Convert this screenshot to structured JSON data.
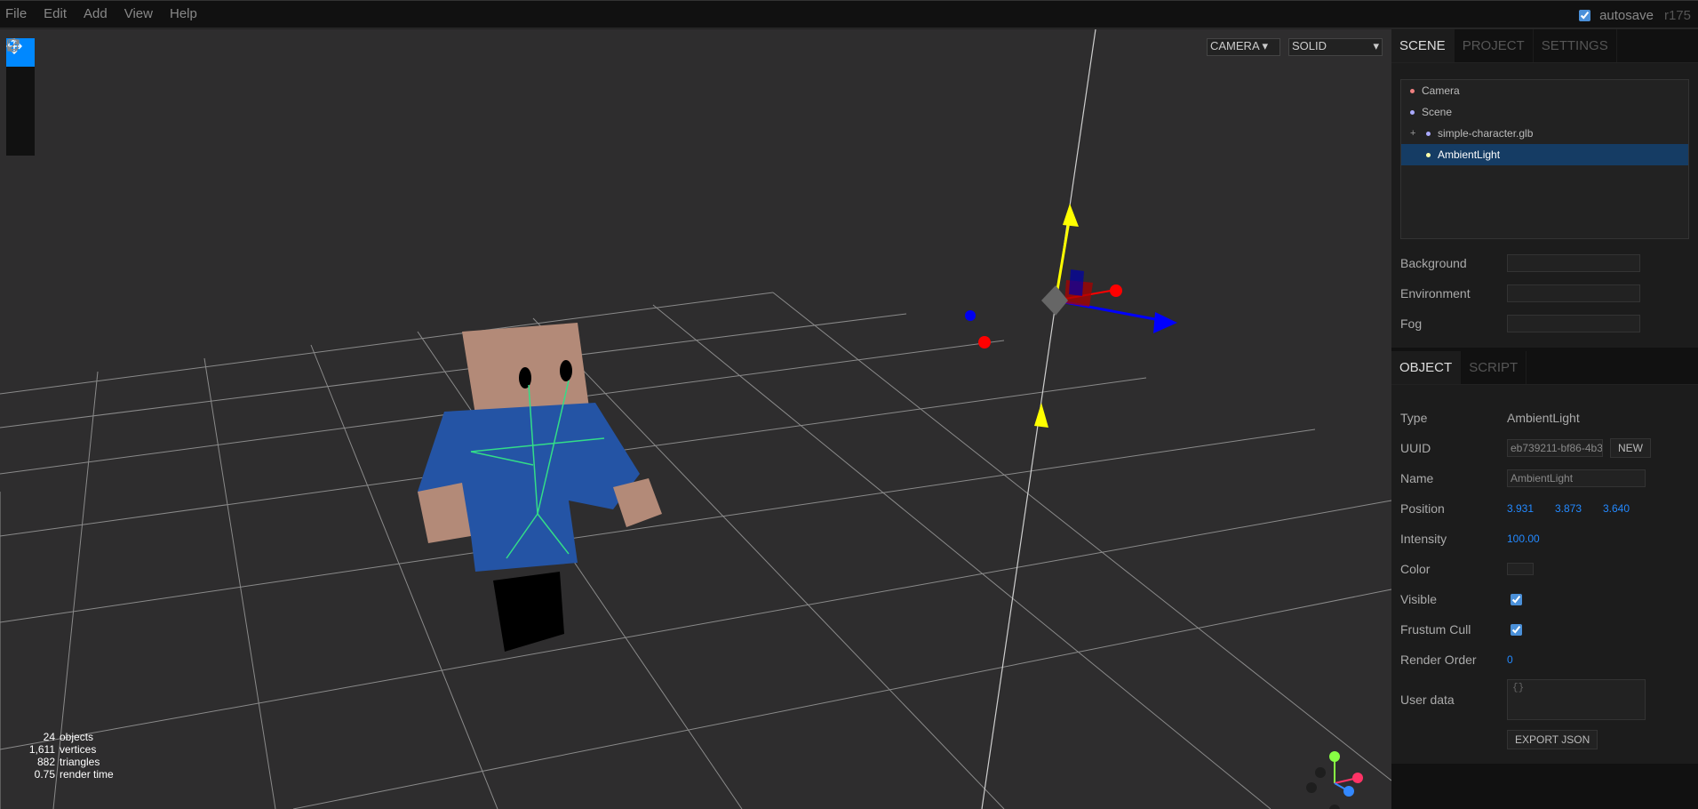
{
  "menubar": {
    "items": [
      "File",
      "Edit",
      "Add",
      "View",
      "Help"
    ],
    "autosave_label": "autosave",
    "version": "r175"
  },
  "viewport": {
    "camera_select": "CAMERA",
    "shading_select": "SOLID",
    "info": [
      {
        "value": "24",
        "label": "objects"
      },
      {
        "value": "1,611",
        "label": "vertices"
      },
      {
        "value": "882",
        "label": "triangles"
      },
      {
        "value": "0.75",
        "label": "render time"
      }
    ],
    "toolbar": [
      "translate-icon",
      "rotate-icon",
      "scale-icon",
      "local-icon"
    ]
  },
  "sidebar": {
    "tabs": [
      "SCENE",
      "PROJECT",
      "SETTINGS"
    ],
    "outliner": [
      {
        "label": "Camera",
        "color": "#f08080"
      },
      {
        "label": "Scene",
        "color": "#aaaaff"
      },
      {
        "label": "simple-character.glb",
        "color": "#aaaaff",
        "opener": "+"
      },
      {
        "label": "AmbientLight",
        "color": "#ffffaa"
      }
    ],
    "scene_props": {
      "background_label": "Background",
      "environment_label": "Environment",
      "fog_label": "Fog"
    },
    "object_tabs": [
      "OBJECT",
      "SCRIPT"
    ],
    "object": {
      "type_label": "Type",
      "type_value": "AmbientLight",
      "uuid_label": "UUID",
      "uuid_value": "eb739211-bf86-4b3",
      "new_label": "NEW",
      "name_label": "Name",
      "name_value": "AmbientLight",
      "position_label": "Position",
      "position_x": "3.931",
      "position_y": "3.873",
      "position_z": "3.640",
      "intensity_label": "Intensity",
      "intensity_value": "100.00",
      "color_label": "Color",
      "visible_label": "Visible",
      "frustum_label": "Frustum Cull",
      "render_order_label": "Render Order",
      "render_order_value": "0",
      "userdata_label": "User data",
      "userdata_value": "{}",
      "export_label": "EXPORT JSON"
    }
  }
}
